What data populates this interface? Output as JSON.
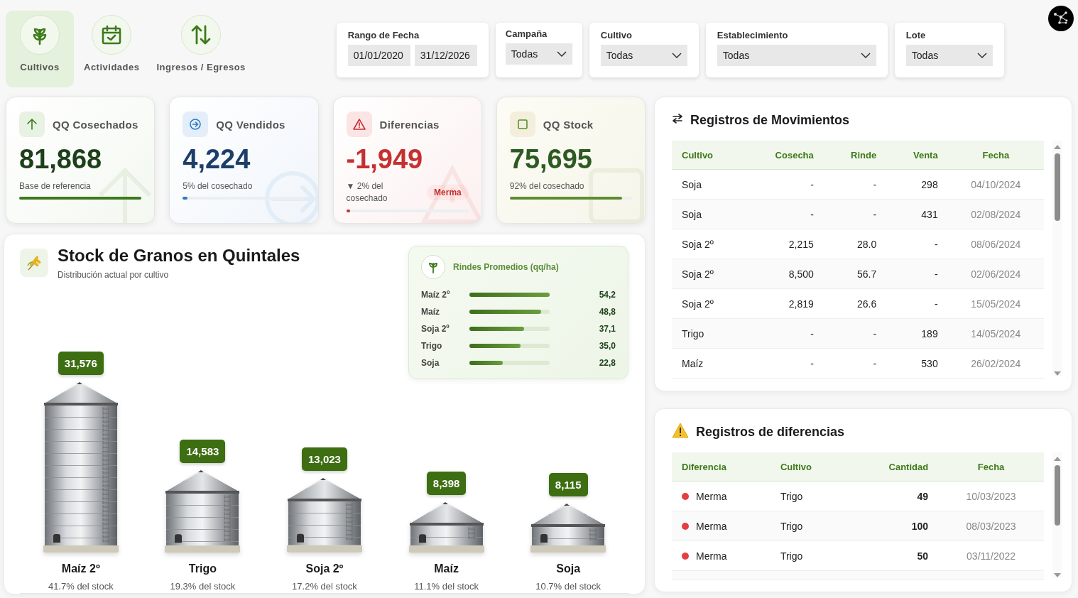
{
  "nav": [
    {
      "label": "Cultivos",
      "kind": "sprout",
      "selected": true
    },
    {
      "label": "Actividades",
      "kind": "calendar",
      "selected": false
    },
    {
      "label": "Ingresos / Egresos",
      "kind": "arrows",
      "selected": false
    }
  ],
  "filters": {
    "date_range": {
      "label": "Rango de Fecha",
      "from": "01/01/2020",
      "to": "31/12/2026"
    },
    "dropdowns": [
      {
        "label": "Campaña",
        "value": "Todas"
      },
      {
        "label": "Cultivo",
        "value": "Todas"
      },
      {
        "label": "Establecimiento",
        "value": "Todas"
      },
      {
        "label": "Lote",
        "value": "Todas"
      }
    ]
  },
  "kpis": [
    {
      "kind": "harvested",
      "title": "QQ Cosechados",
      "value": "81,868",
      "note": "Base de referencia",
      "level": 1.0
    },
    {
      "kind": "sold",
      "title": "QQ Vendidos",
      "value": "4,224",
      "note": "5% del cosechado",
      "level": 0.04
    },
    {
      "kind": "difference",
      "title": "Diferencias",
      "value": "-1,949",
      "note": "▼ 2% del cosechado",
      "badge": "Merma",
      "level": 0.02
    },
    {
      "kind": "stock",
      "title": "QQ Stock",
      "value": "75,695",
      "note": "92% del cosechado",
      "level": 0.92
    }
  ],
  "stock": {
    "title": "Stock de Granos en Quintales",
    "subtitle": "Distribución actual por cultivo",
    "yields": {
      "title": "Rindes Promedios (qq/ha)",
      "rows": [
        {
          "crop": "Maíz 2º",
          "value": "54,2",
          "level": 1.0
        },
        {
          "crop": "Maíz",
          "value": "48,8",
          "level": 0.89
        },
        {
          "crop": "Soja 2º",
          "value": "37,1",
          "level": 0.68
        },
        {
          "crop": "Trigo",
          "value": "35,0",
          "level": 0.64
        },
        {
          "crop": "Soja",
          "value": "22,8",
          "level": 0.42
        }
      ]
    },
    "chart_data": {
      "type": "bar",
      "categories": [
        "Maíz 2º",
        "Trigo",
        "Soja 2º",
        "Maíz",
        "Soja"
      ],
      "values": [
        31576,
        14583,
        13023,
        8398,
        8115
      ],
      "value_labels": [
        "31,576",
        "14,583",
        "13,023",
        "8,398",
        "8,115"
      ]
    },
    "shares": [
      "41.7% del stock",
      "19.3% del stock",
      "17.2% del stock",
      "11.1% del stock",
      "10.7% del stock"
    ]
  },
  "movements": {
    "title": "Registros de Movimientos",
    "columns": [
      "Cultivo",
      "Cosecha",
      "Rinde",
      "Venta",
      "Fecha"
    ],
    "rows": [
      [
        "Soja",
        "-",
        "-",
        "298",
        "04/10/2024"
      ],
      [
        "Soja",
        "-",
        "-",
        "431",
        "02/08/2024"
      ],
      [
        "Soja 2º",
        "2,215",
        "28.0",
        "-",
        "08/06/2024"
      ],
      [
        "Soja 2º",
        "8,500",
        "56.7",
        "-",
        "02/06/2024"
      ],
      [
        "Soja 2º",
        "2,819",
        "26.6",
        "-",
        "15/05/2024"
      ],
      [
        "Trigo",
        "-",
        "-",
        "189",
        "14/05/2024"
      ],
      [
        "Maíz",
        "-",
        "-",
        "530",
        "26/02/2024"
      ]
    ]
  },
  "differences": {
    "title": "Registros de diferencias",
    "columns": [
      "Diferencia",
      "Cultivo",
      "Cantidad",
      "Fecha"
    ],
    "rows": [
      {
        "type": "Merma",
        "color": "#e53e3e",
        "crop": "Trigo",
        "amount": "49",
        "date": "10/03/2023"
      },
      {
        "type": "Merma",
        "color": "#e53e3e",
        "crop": "Trigo",
        "amount": "100",
        "date": "08/03/2023"
      },
      {
        "type": "Merma",
        "color": "#e53e3e",
        "crop": "Trigo",
        "amount": "50",
        "date": "03/11/2022"
      }
    ]
  }
}
